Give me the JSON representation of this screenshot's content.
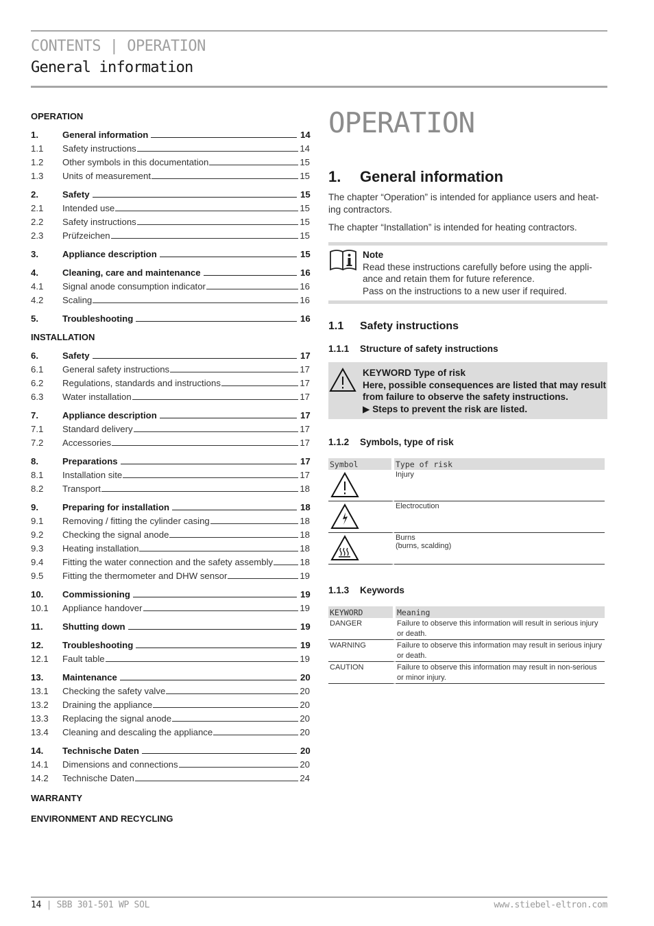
{
  "header": {
    "breadcrumb": "CONTENTS | OPERATION",
    "title": "General information"
  },
  "toc": {
    "groups": [
      {
        "section": "OPERATION",
        "chapters": [
          {
            "num": "1.",
            "label": "General information",
            "page": "14",
            "subs": [
              {
                "num": "1.1",
                "label": "Safety instructions",
                "page": "14"
              },
              {
                "num": "1.2",
                "label": "Other symbols in this documentation",
                "page": "15"
              },
              {
                "num": "1.3",
                "label": "Units of measurement",
                "page": "15"
              }
            ]
          },
          {
            "num": "2.",
            "label": "Safety",
            "page": "15",
            "subs": [
              {
                "num": "2.1",
                "label": "Intended use",
                "page": "15"
              },
              {
                "num": "2.2",
                "label": "Safety instructions",
                "page": "15"
              },
              {
                "num": "2.3",
                "label": "Prüfzeichen",
                "page": "15"
              }
            ]
          },
          {
            "num": "3.",
            "label": "Appliance description",
            "page": "15",
            "subs": []
          },
          {
            "num": "4.",
            "label": "Cleaning, care and maintenance",
            "page": "16",
            "subs": [
              {
                "num": "4.1",
                "label": "Signal anode consumption indicator",
                "page": "16"
              },
              {
                "num": "4.2",
                "label": "Scaling",
                "page": "16"
              }
            ]
          },
          {
            "num": "5.",
            "label": "Troubleshooting",
            "page": "16",
            "subs": []
          }
        ]
      },
      {
        "section": "INSTALLATION",
        "chapters": [
          {
            "num": "6.",
            "label": "Safety",
            "page": "17",
            "subs": [
              {
                "num": "6.1",
                "label": "General safety instructions",
                "page": "17"
              },
              {
                "num": "6.2",
                "label": "Regulations, standards and instructions",
                "page": "17"
              },
              {
                "num": "6.3",
                "label": "Water installation",
                "page": "17"
              }
            ]
          },
          {
            "num": "7.",
            "label": "Appliance description",
            "page": "17",
            "subs": [
              {
                "num": "7.1",
                "label": "Standard delivery",
                "page": "17"
              },
              {
                "num": "7.2",
                "label": "Accessories",
                "page": "17"
              }
            ]
          },
          {
            "num": "8.",
            "label": "Preparations",
            "page": "17",
            "subs": [
              {
                "num": "8.1",
                "label": "Installation site",
                "page": "17"
              },
              {
                "num": "8.2",
                "label": "Transport",
                "page": "18"
              }
            ]
          },
          {
            "num": "9.",
            "label": "Preparing for installation",
            "page": "18",
            "subs": [
              {
                "num": "9.1",
                "label": "Removing / fitting the cylinder casing",
                "page": "18"
              },
              {
                "num": "9.2",
                "label": "Checking the signal anode",
                "page": "18"
              },
              {
                "num": "9.3",
                "label": "Heating installation",
                "page": "18"
              },
              {
                "num": "9.4",
                "label": "Fitting the water connection and the safety assembly",
                "page": "18"
              },
              {
                "num": "9.5",
                "label": "Fitting the thermometer and DHW sensor",
                "page": "19"
              }
            ]
          },
          {
            "num": "10.",
            "label": "Commissioning",
            "page": "19",
            "subs": [
              {
                "num": "10.1",
                "label": "Appliance handover",
                "page": "19"
              }
            ]
          },
          {
            "num": "11.",
            "label": "Shutting down",
            "page": "19",
            "subs": []
          },
          {
            "num": "12.",
            "label": "Troubleshooting",
            "page": "19",
            "subs": [
              {
                "num": "12.1",
                "label": "Fault table",
                "page": "19"
              }
            ]
          },
          {
            "num": "13.",
            "label": "Maintenance",
            "page": "20",
            "subs": [
              {
                "num": "13.1",
                "label": "Checking the safety valve",
                "page": "20"
              },
              {
                "num": "13.2",
                "label": "Draining the appliance",
                "page": "20"
              },
              {
                "num": "13.3",
                "label": "Replacing the signal anode",
                "page": "20"
              },
              {
                "num": "13.4",
                "label": "Cleaning and descaling the appliance",
                "page": "20"
              }
            ]
          },
          {
            "num": "14.",
            "label": "Technische Daten",
            "page": "20",
            "subs": [
              {
                "num": "14.1",
                "label": "Dimensions and connections",
                "page": "20"
              },
              {
                "num": "14.2",
                "label": "Technische Daten",
                "page": "24"
              }
            ]
          }
        ]
      },
      {
        "section": "WARRANTY",
        "chapters": []
      },
      {
        "section": "ENVIRONMENT AND RECYCLING",
        "chapters": []
      }
    ]
  },
  "main": {
    "part_title": "OPERATION",
    "chapter": {
      "num": "1.",
      "title": "General information"
    },
    "intro": [
      "The chapter “Operation” is intended for appliance users and heat-ing contractors.",
      "The chapter “Installation” is intended for heating contractors."
    ],
    "note": {
      "icon": "info-book-icon",
      "title": "Note",
      "lines": [
        "Read these instructions carefully before using the appli-ance and retain them for future reference.",
        "Pass on the instructions to a new user if required."
      ]
    },
    "section_1_1": {
      "num": "1.1",
      "title": "Safety instructions"
    },
    "section_1_1_1": {
      "num": "1.1.1",
      "title": "Structure of safety instructions"
    },
    "safety_box": {
      "icon": "warning-triangle-icon",
      "title": "KEYWORD Type of risk",
      "body": "Here, possible consequences are listed that may result from failure to observe the safety instructions.",
      "step": "▶ Steps to prevent the risk are listed."
    },
    "section_1_1_2": {
      "num": "1.1.2",
      "title": "Symbols, type of risk"
    },
    "symbols_table": {
      "headers": [
        "Symbol",
        "Type of risk"
      ],
      "rows": [
        {
          "icon": "injury-warning-icon",
          "risk": "Injury",
          "risk2": ""
        },
        {
          "icon": "electrocution-warning-icon",
          "risk": "Electrocution",
          "risk2": ""
        },
        {
          "icon": "burns-warning-icon",
          "risk": "Burns",
          "risk2": "(burns, scalding)"
        }
      ]
    },
    "section_1_1_3": {
      "num": "1.1.3",
      "title": "Keywords"
    },
    "keywords_table": {
      "headers": [
        "KEYWORD",
        "Meaning"
      ],
      "rows": [
        {
          "keyword": "DANGER",
          "meaning": "Failure to observe this information will result in serious injury or death."
        },
        {
          "keyword": "WARNING",
          "meaning": "Failure to observe this information may result in serious injury or death."
        },
        {
          "keyword": "CAUTION",
          "meaning": "Failure to observe this information may result in non-serious or minor injury."
        }
      ]
    }
  },
  "footer": {
    "page": "14",
    "separator": " | ",
    "product": "SBB 301-501 WP SOL",
    "url": "www.stiebel-eltron.com"
  },
  "colors": {
    "rule": "#a6a6a6",
    "box_gray": "#dcdcdc",
    "title_gray": "#8c8c8c"
  }
}
